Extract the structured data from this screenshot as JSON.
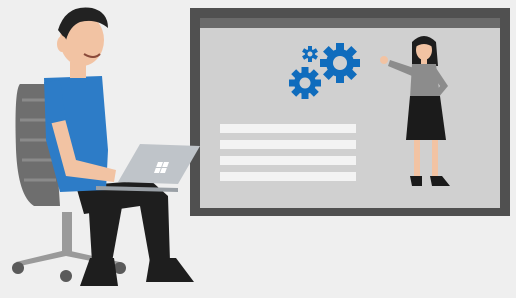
{
  "colors": {
    "background": "#efefef",
    "screen_frame": "#505050",
    "screen_panel": "#d0d0d0",
    "gear": "#0f6cbd",
    "text_line": "#f3f3f3",
    "shirt": "#2d7cc7",
    "pants": "#1e1e1e",
    "skin": "#f2c3a3",
    "hair": "#222222",
    "chair": "#6e6e6e",
    "laptop": "#bfc4c9",
    "woman_top": "#8c8c8c",
    "woman_skirt": "#1b1b1b"
  },
  "icons": {
    "gears": "gears-icon",
    "laptop_logo": "windows-logo-icon"
  },
  "slide_text_lines": 4
}
